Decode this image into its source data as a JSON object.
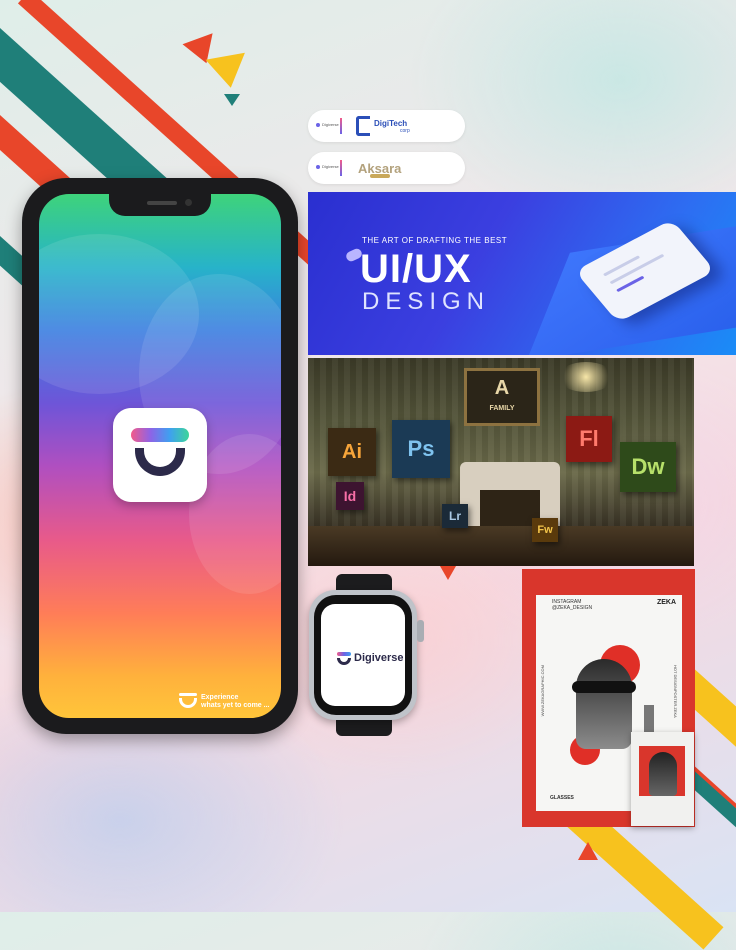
{
  "phone": {
    "tagline_line1": "Experience",
    "tagline_line2": "whats yet to come ..."
  },
  "pills": [
    {
      "small": "Digiverse",
      "brand": "DigiTech",
      "brand_sub": "corp"
    },
    {
      "small": "Digiverse",
      "brand": "Aksara"
    }
  ],
  "uiux_banner": {
    "subtitle": "THE ART OF DRAFTING THE BEST",
    "title": "UI/UX",
    "title2": "DESIGN"
  },
  "adobe_scene": {
    "frame_label": "FAMILY",
    "frame_letter": "A",
    "boxes": [
      "Ai",
      "Ps",
      "Fl",
      "Dw",
      "Id",
      "Lr",
      "Fw"
    ]
  },
  "watch": {
    "brand": "Digiverse"
  },
  "poster": {
    "header_line1": "INSTAGRAM",
    "header_line2": "@ZEKA_DESIGN",
    "brand": "ZEKA",
    "left_text": "WWW.ZEKAGRAPHIC.COM",
    "right_text": "HOT DESIGNPOSTER.ZEKA",
    "bottom_label": "GLASSES"
  },
  "colors": {
    "brand_dark": "#2c2a4a",
    "stripe_red": "#e8462a",
    "stripe_teal": "#1f7f79",
    "stripe_yellow": "#f7c21e",
    "poster_red": "#d9362c"
  }
}
